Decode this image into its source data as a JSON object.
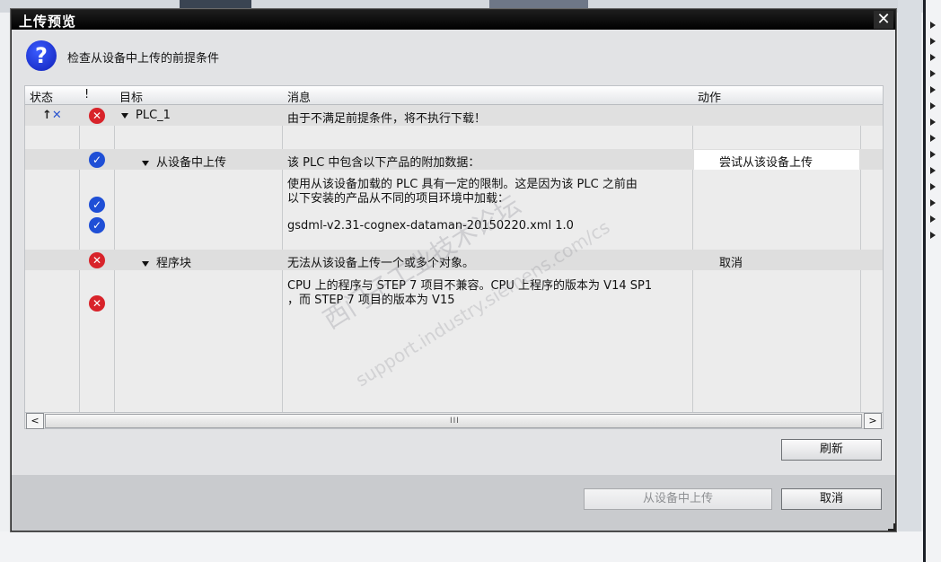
{
  "dialog": {
    "title": "上传预览",
    "close_glyph": "✕",
    "header_text": "检查从设备中上传的前提条件"
  },
  "table": {
    "columns": [
      "状态",
      "!",
      "目标",
      "消息",
      "动作"
    ],
    "rows": [
      {
        "target": "PLC_1",
        "message": "由于不满足前提条件，将不执行下载！",
        "action": ""
      },
      {
        "target": "从设备中上传",
        "message": "该 PLC 中包含以下产品的附加数据：",
        "action": "尝试从该设备上传"
      },
      {
        "target": "",
        "message_line1": "使用从该设备加载的 PLC 具有一定的限制。这是因为该 PLC 之前由",
        "message_line2": "以下安装的产品从不同的项目环境中加载：",
        "action": ""
      },
      {
        "target": "",
        "message": "gsdml-v2.31-cognex-dataman-20150220.xml 1.0",
        "action": ""
      },
      {
        "target": "程序块",
        "message": "无法从该设备上传一个或多个对象。",
        "action": "取消"
      },
      {
        "target": "",
        "message_line1": "CPU 上的程序与 STEP 7 项目不兼容。CPU 上程序的版本为 V14 SP1",
        "message_line2": "，而 STEP 7 项目的版本为 V15",
        "action": ""
      }
    ]
  },
  "scrollbar": {
    "left": "<",
    "right": ">",
    "grip": "III"
  },
  "buttons": {
    "refresh": "刷新",
    "upload": "从设备中上传",
    "cancel": "取消"
  },
  "watermark": {
    "line1": "西门子工业技术论坛",
    "line2": "support.industry.siemens.com/cs"
  },
  "icons": {
    "help": "question-icon",
    "error": "error-x-icon",
    "ok": "check-icon",
    "upload_state": "upload-status-icon"
  },
  "colors": {
    "error": "#d8232a",
    "ok": "#1f4fd6",
    "title_bar": "#000000"
  }
}
